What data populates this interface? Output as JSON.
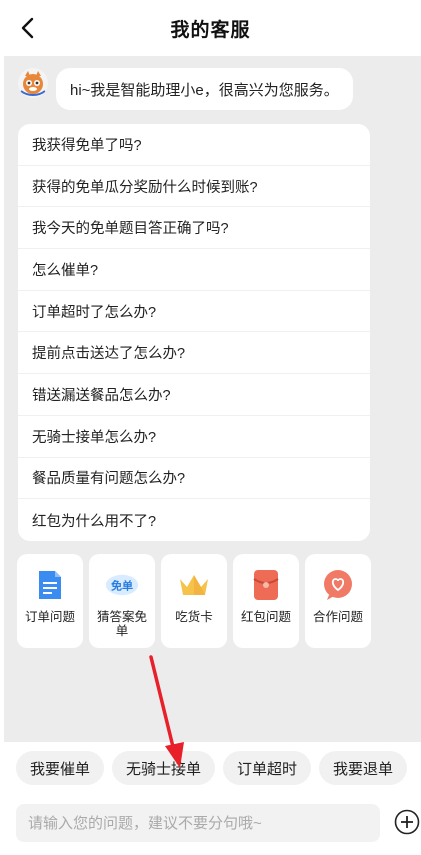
{
  "header": {
    "title": "我的客服",
    "back_icon": "chevron-left-icon"
  },
  "bot": {
    "avatar_icon": "bot-avatar-icon",
    "greeting": "hi~我是智能助理小e，很高兴为您服务。"
  },
  "faq": [
    {
      "label": "我获得免单了吗?"
    },
    {
      "label": "获得的免单瓜分奖励什么时候到账?"
    },
    {
      "label": "我今天的免单题目答正确了吗?"
    },
    {
      "label": "怎么催单?"
    },
    {
      "label": "订单超时了怎么办?"
    },
    {
      "label": "提前点击送达了怎么办?"
    },
    {
      "label": "错送漏送餐品怎么办?"
    },
    {
      "label": "无骑士接单怎么办?"
    },
    {
      "label": "餐品质量有问题怎么办?"
    },
    {
      "label": "红包为什么用不了?"
    }
  ],
  "shortcuts": [
    {
      "label": "订单问题",
      "icon": "document-icon",
      "color": "#3b8cf0"
    },
    {
      "label": "猜答案免单",
      "icon": "free-order-badge-icon",
      "badge_text": "免单",
      "color": "#2a7de0"
    },
    {
      "label": "吃货卡",
      "icon": "crown-icon",
      "color": "#f5c34a"
    },
    {
      "label": "红包问题",
      "icon": "red-envelope-icon",
      "color": "#ee6b55"
    },
    {
      "label": "合作问题",
      "icon": "heart-chat-icon",
      "color": "#f07a66"
    }
  ],
  "quick_replies": [
    {
      "label": "我要催单"
    },
    {
      "label": "无骑士接单"
    },
    {
      "label": "订单超时"
    },
    {
      "label": "我要退单"
    }
  ],
  "input": {
    "placeholder": "请输入您的问题，建议不要分句哦~",
    "plus_icon": "plus-circle-icon"
  },
  "colors": {
    "chat_background": "#ececec",
    "annotation_arrow": "#e8202a"
  }
}
